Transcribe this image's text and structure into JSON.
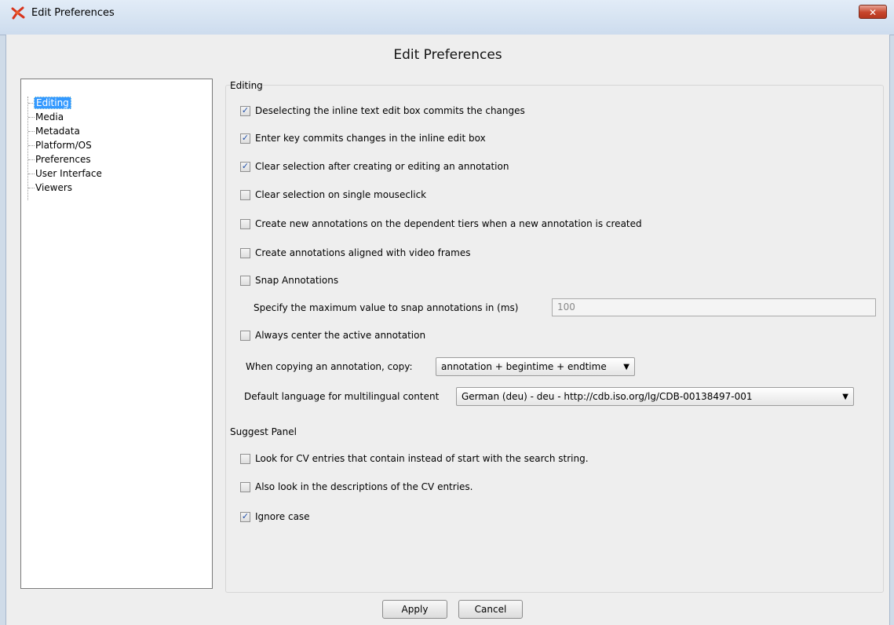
{
  "window": {
    "title": "Edit Preferences",
    "close_glyph": "✕",
    "app_icon": "elan-logo-icon"
  },
  "dialog": {
    "heading": "Edit Preferences"
  },
  "tree": {
    "items": [
      {
        "label": "Editing",
        "selected": true
      },
      {
        "label": "Media"
      },
      {
        "label": "Metadata"
      },
      {
        "label": "Platform/OS"
      },
      {
        "label": "Preferences"
      },
      {
        "label": "User Interface"
      },
      {
        "label": "Viewers"
      }
    ]
  },
  "editing": {
    "section_label": "Editing",
    "options": [
      {
        "label": "Deselecting the inline text edit box commits the changes",
        "checked": true
      },
      {
        "label": "Enter key commits changes in the inline edit box",
        "checked": true
      },
      {
        "label": "Clear selection after creating or editing an annotation",
        "checked": true
      },
      {
        "label": "Clear selection on single mouseclick",
        "checked": false
      },
      {
        "label": "Create new annotations on the dependent tiers when a new annotation is created",
        "checked": false
      },
      {
        "label": "Create annotations aligned with video frames",
        "checked": false
      },
      {
        "label": "Snap Annotations",
        "checked": false
      }
    ],
    "snap_label": "Specify the maximum value to snap annotations in (ms)",
    "snap_value": "100",
    "center_option": {
      "label": "Always center the active annotation",
      "checked": false
    },
    "copy_label": "When copying an annotation, copy:",
    "copy_value": "annotation + begintime + endtime",
    "language_label": "Default language for multilingual content",
    "language_value": "German (deu) - deu - http://cdb.iso.org/lg/CDB-00138497-001"
  },
  "suggest": {
    "section_label": "Suggest Panel",
    "options": [
      {
        "label": "Look for CV entries that contain instead of start with the search string.",
        "checked": false
      },
      {
        "label": "Also look in the descriptions of the CV entries.",
        "checked": false
      },
      {
        "label": "Ignore case",
        "checked": true
      }
    ]
  },
  "buttons": {
    "apply": "Apply",
    "cancel": "Cancel"
  },
  "glyphs": {
    "check": "✓",
    "dropdown": "▼"
  },
  "colors": {
    "selection": "#3399ff",
    "close_button": "#c7452b"
  }
}
